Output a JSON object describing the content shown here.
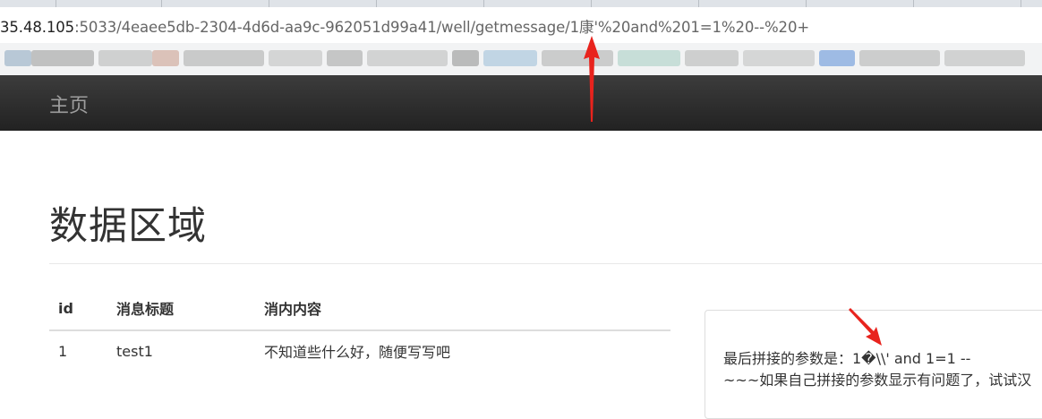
{
  "browser": {
    "url_host": "35.48.105",
    "url_path": ":5033/4eaee5db-2304-4d6d-aa9c-962051d99a41/well/getmessage/1康'%20and%201=1%20--%20+"
  },
  "nav": {
    "home_label": "主页"
  },
  "main": {
    "title": "数据区域"
  },
  "table": {
    "headers": [
      "id",
      "消息标题",
      "消内内容"
    ],
    "rows": [
      [
        "1",
        "test1",
        "不知道些什么好，随便写写吧"
      ]
    ]
  },
  "panel": {
    "line1": "最后拼接的参数是：1�\\\\' and 1=1 --",
    "line2": "~~~如果自己拼接的参数显示有问题了，试试汉"
  },
  "colors": {
    "annotation_arrow": "#e8231d",
    "navbar": "#2b2b2b",
    "nav_text": "#9d9d9d"
  }
}
